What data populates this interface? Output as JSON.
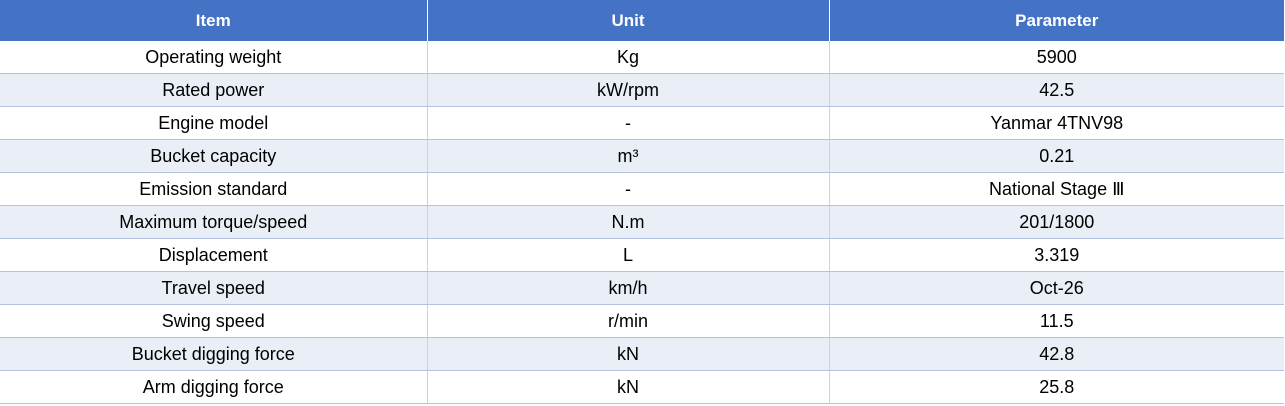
{
  "table": {
    "headers": [
      "Item",
      "Unit",
      "Parameter"
    ],
    "rows": [
      [
        "Operating weight",
        "Kg",
        "5900"
      ],
      [
        "Rated power",
        "kW/rpm",
        "42.5"
      ],
      [
        "Engine model",
        "-",
        "Yanmar 4TNV98"
      ],
      [
        "Bucket capacity",
        "m³",
        "0.21"
      ],
      [
        "Emission standard",
        "-",
        "National Stage Ⅲ"
      ],
      [
        "Maximum torque/speed",
        "N.m",
        "201/1800"
      ],
      [
        "Displacement",
        "L",
        "3.319"
      ],
      [
        "Travel speed",
        "km/h",
        "Oct-26"
      ],
      [
        "Swing speed",
        "r/min",
        "11.5"
      ],
      [
        "Bucket digging force",
        "kN",
        "42.8"
      ],
      [
        "Arm digging force",
        "kN",
        "25.8"
      ]
    ]
  },
  "colors": {
    "header_bg": "#4472c4",
    "header_text": "#ffffff",
    "row_alt_bg": "#e9eef7",
    "row_bg": "#ffffff"
  }
}
